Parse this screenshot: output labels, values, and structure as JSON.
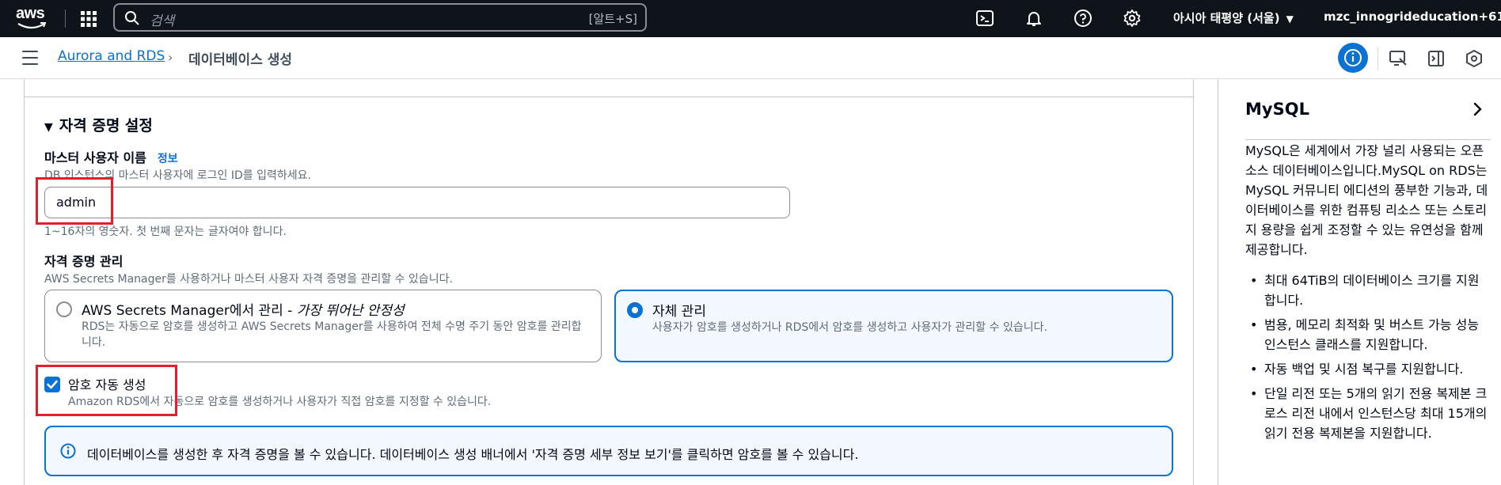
{
  "topnav": {
    "logo_text": "aws",
    "search_placeholder": "검색",
    "search_shortcut": "[알트+S]",
    "region": "아시아 태평양 (서울)",
    "account": "mzc_innogrideducation+61"
  },
  "breadcrumb": {
    "parent": "Aurora and RDS",
    "separator": "›",
    "current": "데이터베이스 생성"
  },
  "form": {
    "section_title": "자격 증명 설정",
    "master_username": {
      "label": "마스터 사용자 이름",
      "info_link": "정보",
      "description": "DB 인스턴스의 마스터 사용자에 로그인 ID를 입력하세요.",
      "value": "admin",
      "constraint": "1~16자의 영숫자. 첫 번째 문자는 글자여야 합니다."
    },
    "credential_management": {
      "label": "자격 증명 관리",
      "description": "AWS Secrets Manager를 사용하거나 마스터 사용자 자격 증명을 관리할 수 있습니다.",
      "options": [
        {
          "title_main": "AWS Secrets Manager에서 관리 - ",
          "title_emph": "가장 뛰어난 안정성",
          "description": "RDS는 자동으로 암호를 생성하고 AWS Secrets Manager를 사용하여 전체 수명 주기 동안 암호를 관리합니다.",
          "selected": false
        },
        {
          "title_main": "자체 관리",
          "title_emph": "",
          "description": "사용자가 암호를 생성하거나 RDS에서 암호를 생성하고 사용자가 관리할 수 있습니다.",
          "selected": true
        }
      ]
    },
    "auto_password": {
      "label": "암호 자동 생성",
      "description": "Amazon RDS에서 자동으로 암호를 생성하거나 사용자가 직접 암호를 지정할 수 있습니다.",
      "checked": true
    },
    "info_alert": "데이터베이스를 생성한 후 자격 증명을 볼 수 있습니다. 데이터베이스 생성 배너에서 '자격 증명 세부 정보 보기'를 클릭하면 암호를 볼 수 있습니다."
  },
  "help_panel": {
    "title": "MySQL",
    "body": "MySQL은 세계에서 가장 널리 사용되는 오픈 소스 데이터베이스입니다.MySQL on RDS는 MySQL 커뮤니티 에디션의 풍부한 기능과, 데이터베이스를 위한 컴퓨팅 리소스 또는 스토리지 용량을 쉽게 조정할 수 있는 유연성을 함께 제공합니다.",
    "bullets": [
      "최대 64TiB의 데이터베이스 크기를 지원합니다.",
      "범용, 메모리 최적화 및 버스트 가능 성능 인스턴스 클래스를 지원합니다.",
      "자동 백업 및 시점 복구를 지원합니다.",
      "단일 리전 또는 5개의 읽기 전용 복제본 크로스 리전 내에서 인스턴스당 최대 15개의 읽기 전용 복제본을 지원합니다."
    ]
  },
  "colors": {
    "nav_bg": "#0f141a",
    "accent": "#0972d3",
    "highlight": "#e0212b"
  }
}
